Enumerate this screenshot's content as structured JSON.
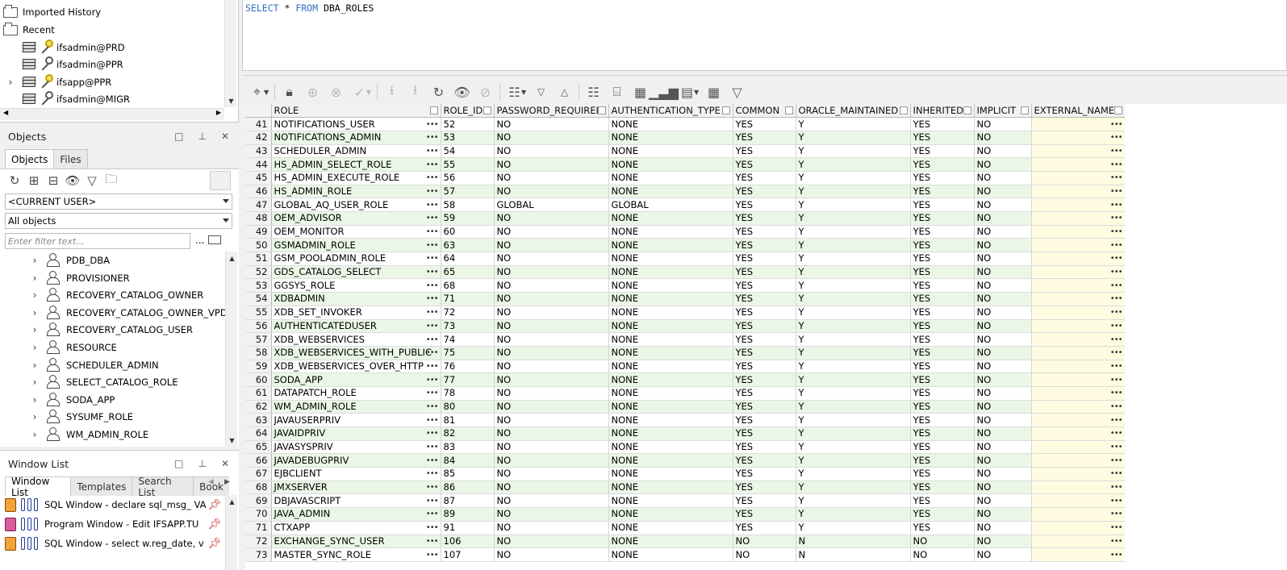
{
  "connections_tree": {
    "folders": [
      "Imported History",
      "Recent"
    ],
    "connections": [
      {
        "label": "ifsadmin@PRD",
        "key_color": "gold",
        "expandable": false
      },
      {
        "label": "ifsadmin@PPR",
        "key_color": "gray",
        "expandable": false
      },
      {
        "label": "ifsapp@PPR",
        "key_color": "gold",
        "expandable": true
      },
      {
        "label": "ifsadmin@MIGR",
        "key_color": "gray",
        "expandable": false
      }
    ]
  },
  "objects_panel": {
    "title": "Objects",
    "tabs": [
      "Objects",
      "Files"
    ],
    "user_select": "<CURRENT USER>",
    "type_select": "All objects",
    "filter_placeholder": "Enter filter text...",
    "filter_more": "...",
    "items": [
      "PDB_DBA",
      "PROVISIONER",
      "RECOVERY_CATALOG_OWNER",
      "RECOVERY_CATALOG_OWNER_VPD",
      "RECOVERY_CATALOG_USER",
      "RESOURCE",
      "SCHEDULER_ADMIN",
      "SELECT_CATALOG_ROLE",
      "SODA_APP",
      "SYSUMF_ROLE",
      "WM_ADMIN_ROLE"
    ]
  },
  "window_list": {
    "title": "Window List",
    "tabs": [
      "Window List",
      "Templates",
      "Search List",
      "Book"
    ],
    "items": [
      {
        "label": "SQL Window - declare sql_msg_ VA",
        "icon": "sql-window-icon"
      },
      {
        "label": "Program Window - Edit IFSAPP.TU",
        "icon": "program-window-icon"
      },
      {
        "label": "SQL Window - select w.reg_date, v",
        "icon": "sql-window-icon"
      }
    ]
  },
  "editor": {
    "kw1": "SELECT",
    "mid": " * ",
    "kw2": "FROM",
    "table": " DBA_ROLES"
  },
  "grid": {
    "columns": [
      "ROLE",
      "ROLE_ID",
      "PASSWORD_REQUIRED",
      "AUTHENTICATION_TYPE",
      "COMMON",
      "ORACLE_MAINTAINED",
      "INHERITED",
      "IMPLICIT",
      "EXTERNAL_NAME"
    ],
    "rows": [
      [
        "41",
        "NOTIFICATIONS_USER",
        "52",
        "NO",
        "NONE",
        "YES",
        "Y",
        "YES",
        "NO",
        ""
      ],
      [
        "42",
        "NOTIFICATIONS_ADMIN",
        "53",
        "NO",
        "NONE",
        "YES",
        "Y",
        "YES",
        "NO",
        ""
      ],
      [
        "43",
        "SCHEDULER_ADMIN",
        "54",
        "NO",
        "NONE",
        "YES",
        "Y",
        "YES",
        "NO",
        ""
      ],
      [
        "44",
        "HS_ADMIN_SELECT_ROLE",
        "55",
        "NO",
        "NONE",
        "YES",
        "Y",
        "YES",
        "NO",
        ""
      ],
      [
        "45",
        "HS_ADMIN_EXECUTE_ROLE",
        "56",
        "NO",
        "NONE",
        "YES",
        "Y",
        "YES",
        "NO",
        ""
      ],
      [
        "46",
        "HS_ADMIN_ROLE",
        "57",
        "NO",
        "NONE",
        "YES",
        "Y",
        "YES",
        "NO",
        ""
      ],
      [
        "47",
        "GLOBAL_AQ_USER_ROLE",
        "58",
        "GLOBAL",
        "GLOBAL",
        "YES",
        "Y",
        "YES",
        "NO",
        ""
      ],
      [
        "48",
        "OEM_ADVISOR",
        "59",
        "NO",
        "NONE",
        "YES",
        "Y",
        "YES",
        "NO",
        ""
      ],
      [
        "49",
        "OEM_MONITOR",
        "60",
        "NO",
        "NONE",
        "YES",
        "Y",
        "YES",
        "NO",
        ""
      ],
      [
        "50",
        "GSMADMIN_ROLE",
        "63",
        "NO",
        "NONE",
        "YES",
        "Y",
        "YES",
        "NO",
        ""
      ],
      [
        "51",
        "GSM_POOLADMIN_ROLE",
        "64",
        "NO",
        "NONE",
        "YES",
        "Y",
        "YES",
        "NO",
        ""
      ],
      [
        "52",
        "GDS_CATALOG_SELECT",
        "65",
        "NO",
        "NONE",
        "YES",
        "Y",
        "YES",
        "NO",
        ""
      ],
      [
        "53",
        "GGSYS_ROLE",
        "68",
        "NO",
        "NONE",
        "YES",
        "Y",
        "YES",
        "NO",
        ""
      ],
      [
        "54",
        "XDBADMIN",
        "71",
        "NO",
        "NONE",
        "YES",
        "Y",
        "YES",
        "NO",
        ""
      ],
      [
        "55",
        "XDB_SET_INVOKER",
        "72",
        "NO",
        "NONE",
        "YES",
        "Y",
        "YES",
        "NO",
        ""
      ],
      [
        "56",
        "AUTHENTICATEDUSER",
        "73",
        "NO",
        "NONE",
        "YES",
        "Y",
        "YES",
        "NO",
        ""
      ],
      [
        "57",
        "XDB_WEBSERVICES",
        "74",
        "NO",
        "NONE",
        "YES",
        "Y",
        "YES",
        "NO",
        ""
      ],
      [
        "58",
        "XDB_WEBSERVICES_WITH_PUBLIC",
        "75",
        "NO",
        "NONE",
        "YES",
        "Y",
        "YES",
        "NO",
        ""
      ],
      [
        "59",
        "XDB_WEBSERVICES_OVER_HTTP",
        "76",
        "NO",
        "NONE",
        "YES",
        "Y",
        "YES",
        "NO",
        ""
      ],
      [
        "60",
        "SODA_APP",
        "77",
        "NO",
        "NONE",
        "YES",
        "Y",
        "YES",
        "NO",
        ""
      ],
      [
        "61",
        "DATAPATCH_ROLE",
        "78",
        "NO",
        "NONE",
        "YES",
        "Y",
        "YES",
        "NO",
        ""
      ],
      [
        "62",
        "WM_ADMIN_ROLE",
        "80",
        "NO",
        "NONE",
        "YES",
        "Y",
        "YES",
        "NO",
        ""
      ],
      [
        "63",
        "JAVAUSERPRIV",
        "81",
        "NO",
        "NONE",
        "YES",
        "Y",
        "YES",
        "NO",
        ""
      ],
      [
        "64",
        "JAVAIDPRIV",
        "82",
        "NO",
        "NONE",
        "YES",
        "Y",
        "YES",
        "NO",
        ""
      ],
      [
        "65",
        "JAVASYSPRIV",
        "83",
        "NO",
        "NONE",
        "YES",
        "Y",
        "YES",
        "NO",
        ""
      ],
      [
        "66",
        "JAVADEBUGPRIV",
        "84",
        "NO",
        "NONE",
        "YES",
        "Y",
        "YES",
        "NO",
        ""
      ],
      [
        "67",
        "EJBCLIENT",
        "85",
        "NO",
        "NONE",
        "YES",
        "Y",
        "YES",
        "NO",
        ""
      ],
      [
        "68",
        "JMXSERVER",
        "86",
        "NO",
        "NONE",
        "YES",
        "Y",
        "YES",
        "NO",
        ""
      ],
      [
        "69",
        "DBJAVASCRIPT",
        "87",
        "NO",
        "NONE",
        "YES",
        "Y",
        "YES",
        "NO",
        ""
      ],
      [
        "70",
        "JAVA_ADMIN",
        "89",
        "NO",
        "NONE",
        "YES",
        "Y",
        "YES",
        "NO",
        ""
      ],
      [
        "71",
        "CTXAPP",
        "91",
        "NO",
        "NONE",
        "YES",
        "Y",
        "YES",
        "NO",
        ""
      ],
      [
        "72",
        "EXCHANGE_SYNC_USER",
        "106",
        "NO",
        "NONE",
        "NO",
        "N",
        "NO",
        "NO",
        ""
      ],
      [
        "73",
        "MASTER_SYNC_ROLE",
        "107",
        "NO",
        "NONE",
        "NO",
        "N",
        "NO",
        "NO",
        ""
      ]
    ]
  },
  "colors": {
    "keyword": "#2f6ec2",
    "alt_row": "#eaf7e6",
    "external_name_cell": "#fffbe1",
    "pin": "#c21d1d"
  }
}
